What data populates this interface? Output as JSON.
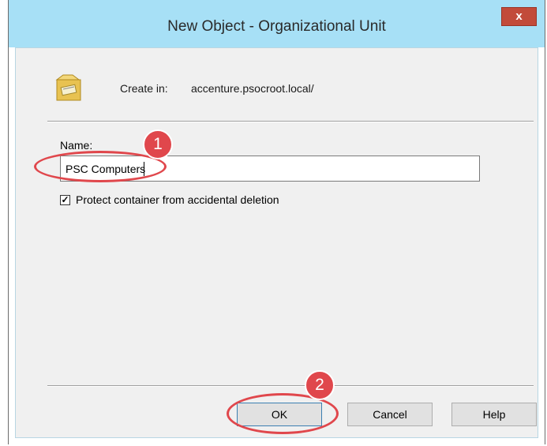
{
  "window": {
    "title": "New Object - Organizational Unit",
    "close_label": "x"
  },
  "create_in": {
    "label": "Create in:",
    "value": "accenture.psocroot.local/"
  },
  "name_field": {
    "label": "Name:",
    "value": "PSC Computers"
  },
  "protect_checkbox": {
    "label": "Protect container from accidental deletion",
    "checked": true,
    "mark": "✓"
  },
  "buttons": {
    "ok": "OK",
    "cancel": "Cancel",
    "help": "Help"
  },
  "annotations": [
    {
      "number": "1"
    },
    {
      "number": "2"
    }
  ],
  "colors": {
    "titlebar": "#a7e0f6",
    "close": "#c24b3a",
    "annotation": "#e0474c"
  }
}
